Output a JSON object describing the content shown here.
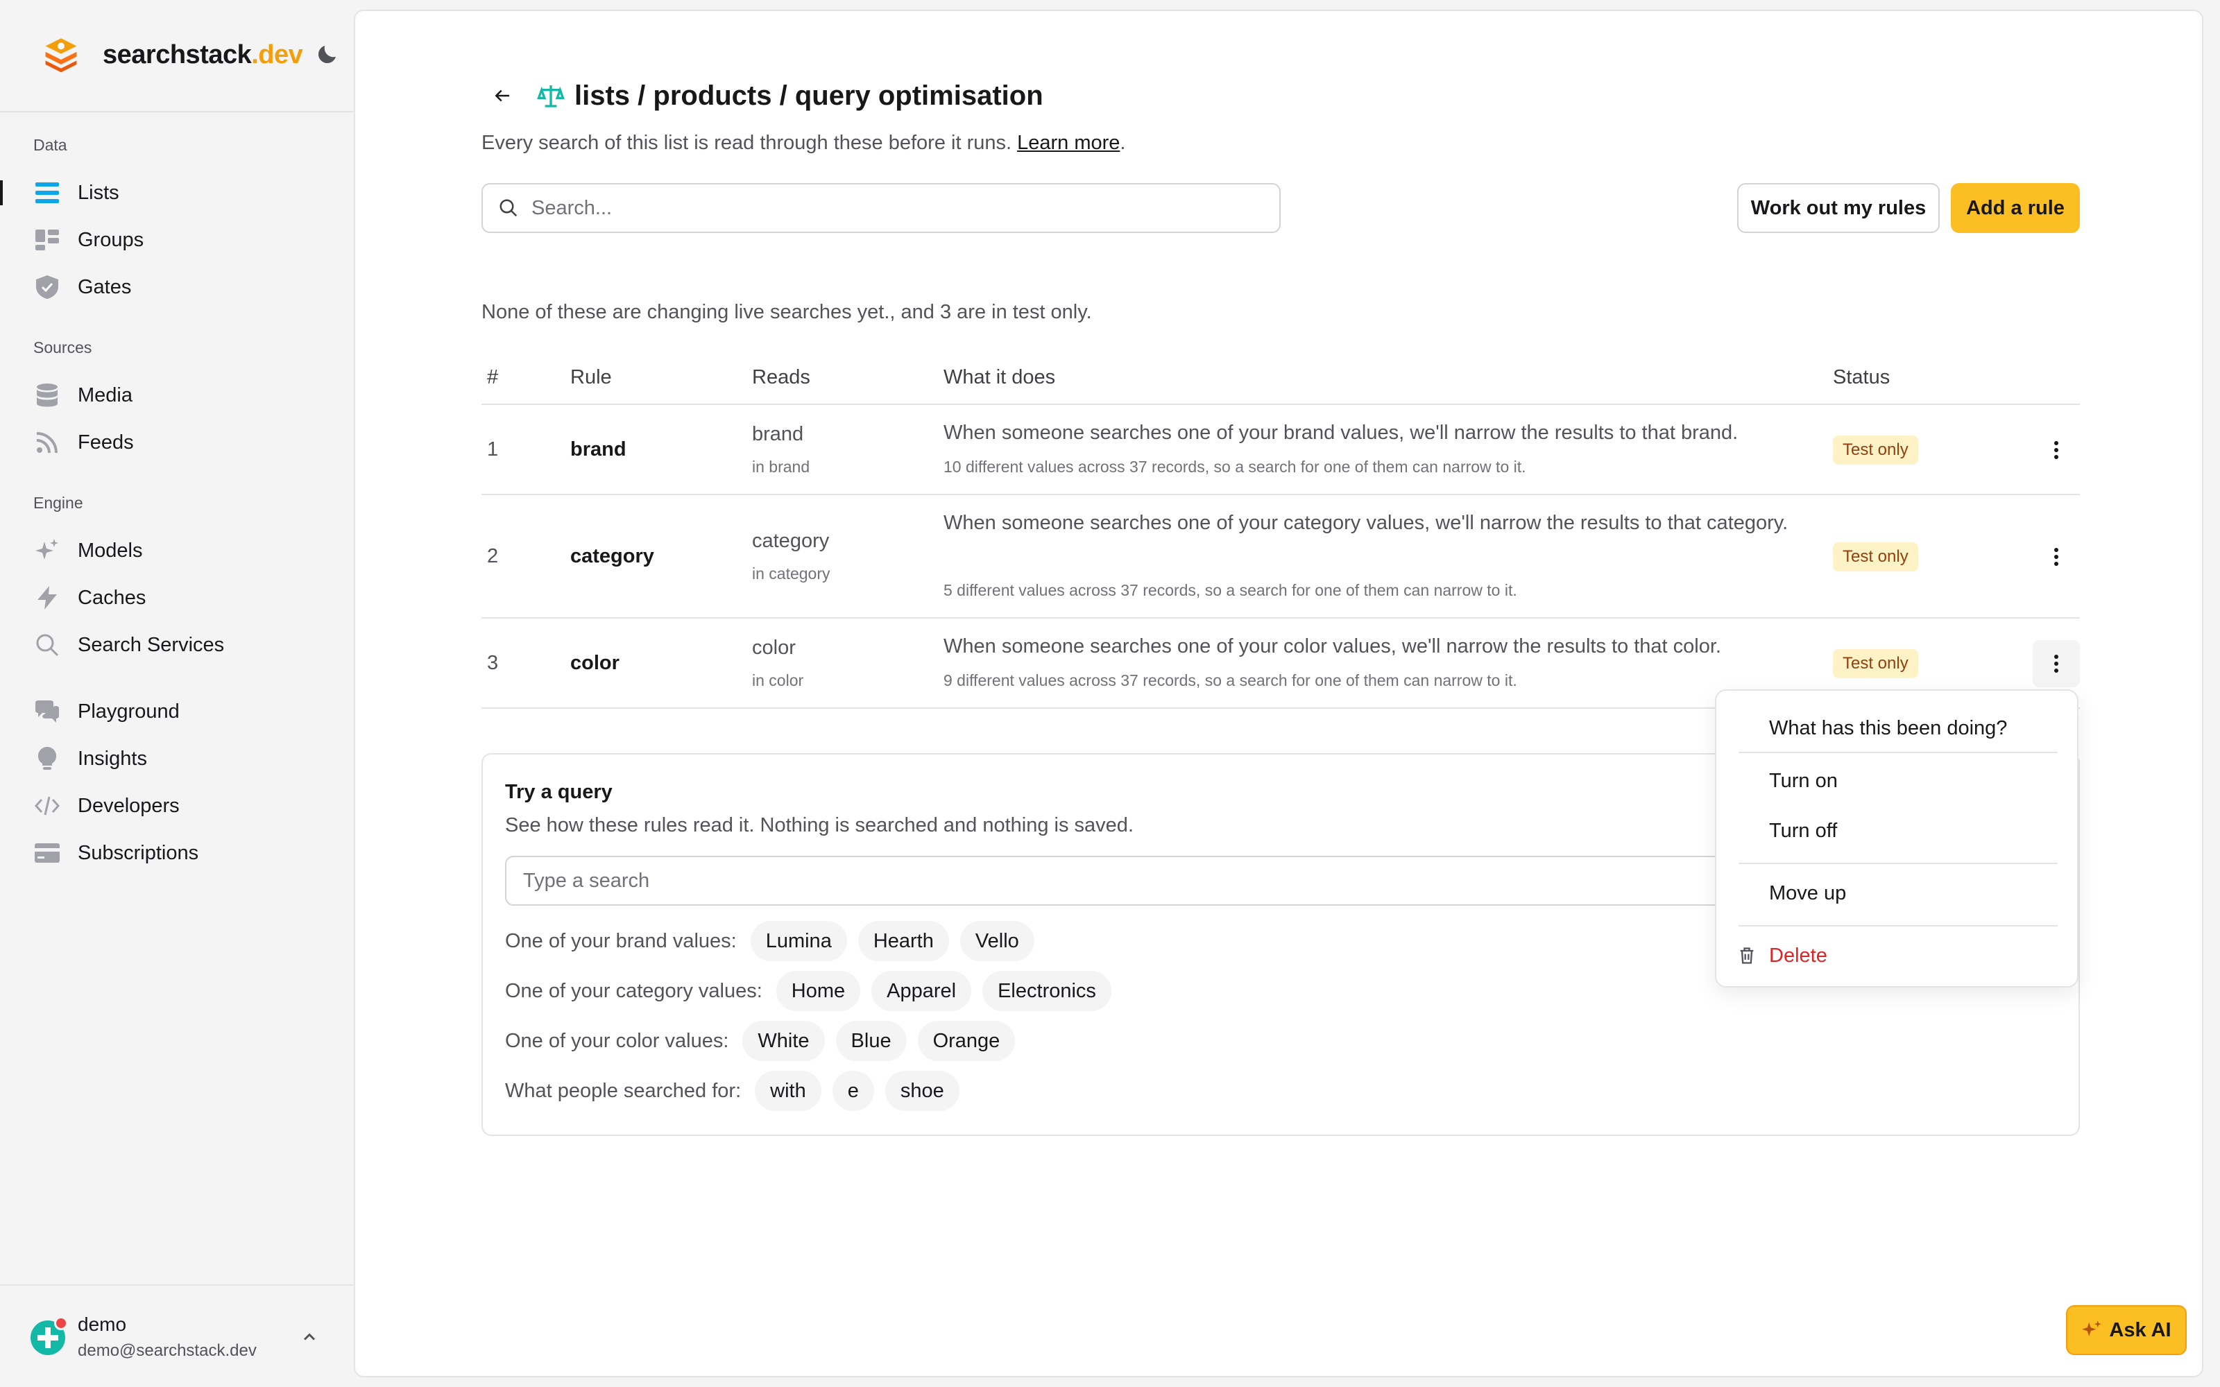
{
  "app": {
    "brand_main": "searchstack",
    "brand_tld": ".dev",
    "accent": "#fbbf24"
  },
  "sidebar": {
    "sections": [
      {
        "title": "Data",
        "items": [
          {
            "label": "Lists",
            "icon": "list-icon",
            "active": true
          },
          {
            "label": "Groups",
            "icon": "groups-icon"
          },
          {
            "label": "Gates",
            "icon": "shield-icon"
          }
        ]
      },
      {
        "title": "Sources",
        "items": [
          {
            "label": "Media",
            "icon": "database-icon"
          },
          {
            "label": "Feeds",
            "icon": "rss-icon"
          }
        ]
      },
      {
        "title": "Engine",
        "items": [
          {
            "label": "Models",
            "icon": "sparkles-icon"
          },
          {
            "label": "Caches",
            "icon": "bolt-icon"
          },
          {
            "label": "Search Services",
            "icon": "search-icon"
          }
        ]
      },
      {
        "title": "",
        "items": [
          {
            "label": "Playground",
            "icon": "chat-icon"
          },
          {
            "label": "Insights",
            "icon": "lightbulb-icon"
          },
          {
            "label": "Developers",
            "icon": "code-icon"
          },
          {
            "label": "Subscriptions",
            "icon": "credit-card-icon"
          }
        ]
      }
    ],
    "user": {
      "name": "demo",
      "email": "demo@searchstack.dev"
    }
  },
  "header": {
    "title": "lists / products / query optimisation",
    "subtitle": "Every search of this list is read through these before it runs.",
    "learn_more": "Learn more",
    "subtitle_end": "."
  },
  "toolbar": {
    "search_placeholder": "Search...",
    "work_out_label": "Work out my rules",
    "add_rule_label": "Add a rule"
  },
  "summary": "None of these are changing live searches yet., and 3 are in test only.",
  "table": {
    "columns": [
      "#",
      "Rule",
      "Reads",
      "What it does",
      "Status"
    ],
    "rows": [
      {
        "num": "1",
        "rule": "brand",
        "reads": "brand",
        "reads_sub": "in brand",
        "desc": "When someone searches one of your brand values, we'll narrow the results to that brand.",
        "desc_sub": "10 different values across 37 records, so a search for one of them can narrow to it.",
        "status": "Test only"
      },
      {
        "num": "2",
        "rule": "category",
        "reads": "category",
        "reads_sub": "in category",
        "desc": "When someone searches one of your category values, we'll narrow the results to that category.",
        "desc_sub": "5 different values across 37 records, so a search for one of them can narrow to it.",
        "status": "Test only"
      },
      {
        "num": "3",
        "rule": "color",
        "reads": "color",
        "reads_sub": "in color",
        "desc": "When someone searches one of your color values, we'll narrow the results to that color.",
        "desc_sub": "9 different values across 37 records, so a search for one of them can narrow to it.",
        "status": "Test only"
      }
    ]
  },
  "try_query": {
    "title": "Try a query",
    "description": "See how these rules read it. Nothing is searched and nothing is saved.",
    "placeholder": "Type a search",
    "groups": [
      {
        "label": "One of your brand values:",
        "chips": [
          "Lumina",
          "Hearth",
          "Vello"
        ]
      },
      {
        "label": "One of your category values:",
        "chips": [
          "Home",
          "Apparel",
          "Electronics"
        ]
      },
      {
        "label": "One of your color values:",
        "chips": [
          "White",
          "Blue",
          "Orange"
        ]
      },
      {
        "label": "What people searched for:",
        "chips": [
          "with",
          "e",
          "shoe"
        ]
      }
    ]
  },
  "menu": {
    "items": [
      "What has this been doing?",
      "Turn on",
      "Turn off",
      "Move up",
      "Delete"
    ]
  },
  "ask_ai_label": "Ask AI"
}
